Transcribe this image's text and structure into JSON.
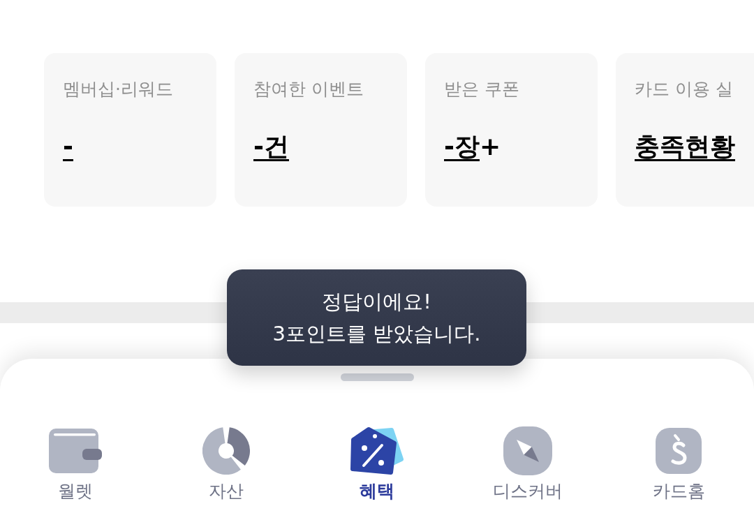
{
  "cards": [
    {
      "label": "멤버십·리워드",
      "value": "-"
    },
    {
      "label": "참여한 이벤트",
      "value": "-건"
    },
    {
      "label": "받은 쿠폰",
      "value": "-장",
      "suffix": "+"
    },
    {
      "label": "카드 이용 실",
      "value": "충족현황"
    }
  ],
  "toast": {
    "message": "정답이에요!\n3포인트를 받았습니다."
  },
  "tab_bar": {
    "tabs": [
      {
        "label": "월렛",
        "selected": false
      },
      {
        "label": "자산",
        "selected": false
      },
      {
        "label": "혜택",
        "selected": true
      },
      {
        "label": "디스커버",
        "selected": false
      },
      {
        "label": "카드홈",
        "selected": false
      }
    ]
  }
}
